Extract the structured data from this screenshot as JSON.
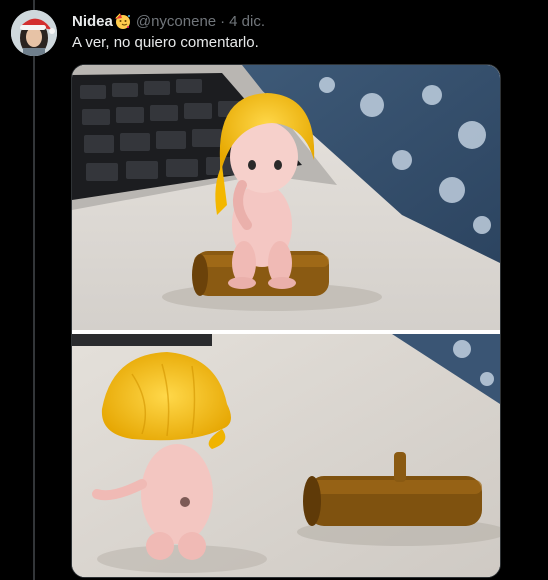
{
  "tweet": {
    "display_name": "Nidea",
    "name_emoji": "party-face-emoji",
    "handle": "@nyconene",
    "separator": "·",
    "date": "4 dic.",
    "text": "A ver, no quiero comentarlo."
  },
  "avatar": {
    "icon": "santa-hat-avatar"
  },
  "media": {
    "photos": [
      {
        "description_icon": "blonde-doll-sitting-on-log-photo"
      },
      {
        "description_icon": "blonde-doll-back-with-log-photo"
      }
    ]
  },
  "colors": {
    "background": "#000000",
    "primary_text": "#e7e9ea",
    "secondary_text": "#71767b",
    "thread_line": "#333639"
  }
}
